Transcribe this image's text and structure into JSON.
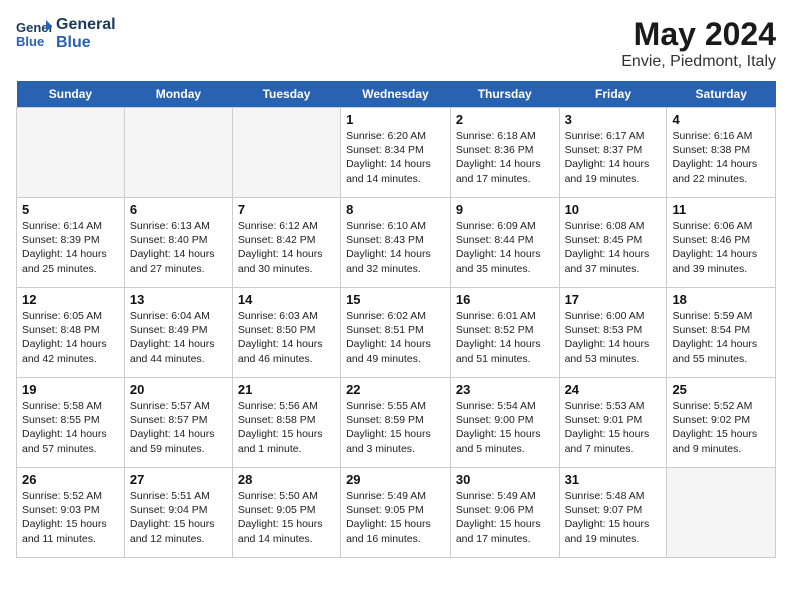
{
  "header": {
    "logo_text_general": "General",
    "logo_text_blue": "Blue",
    "month_year": "May 2024",
    "location": "Envie, Piedmont, Italy"
  },
  "days_of_week": [
    "Sunday",
    "Monday",
    "Tuesday",
    "Wednesday",
    "Thursday",
    "Friday",
    "Saturday"
  ],
  "weeks": [
    [
      {
        "day": "",
        "info": ""
      },
      {
        "day": "",
        "info": ""
      },
      {
        "day": "",
        "info": ""
      },
      {
        "day": "1",
        "info": "Sunrise: 6:20 AM\nSunset: 8:34 PM\nDaylight: 14 hours and 14 minutes."
      },
      {
        "day": "2",
        "info": "Sunrise: 6:18 AM\nSunset: 8:36 PM\nDaylight: 14 hours and 17 minutes."
      },
      {
        "day": "3",
        "info": "Sunrise: 6:17 AM\nSunset: 8:37 PM\nDaylight: 14 hours and 19 minutes."
      },
      {
        "day": "4",
        "info": "Sunrise: 6:16 AM\nSunset: 8:38 PM\nDaylight: 14 hours and 22 minutes."
      }
    ],
    [
      {
        "day": "5",
        "info": "Sunrise: 6:14 AM\nSunset: 8:39 PM\nDaylight: 14 hours and 25 minutes."
      },
      {
        "day": "6",
        "info": "Sunrise: 6:13 AM\nSunset: 8:40 PM\nDaylight: 14 hours and 27 minutes."
      },
      {
        "day": "7",
        "info": "Sunrise: 6:12 AM\nSunset: 8:42 PM\nDaylight: 14 hours and 30 minutes."
      },
      {
        "day": "8",
        "info": "Sunrise: 6:10 AM\nSunset: 8:43 PM\nDaylight: 14 hours and 32 minutes."
      },
      {
        "day": "9",
        "info": "Sunrise: 6:09 AM\nSunset: 8:44 PM\nDaylight: 14 hours and 35 minutes."
      },
      {
        "day": "10",
        "info": "Sunrise: 6:08 AM\nSunset: 8:45 PM\nDaylight: 14 hours and 37 minutes."
      },
      {
        "day": "11",
        "info": "Sunrise: 6:06 AM\nSunset: 8:46 PM\nDaylight: 14 hours and 39 minutes."
      }
    ],
    [
      {
        "day": "12",
        "info": "Sunrise: 6:05 AM\nSunset: 8:48 PM\nDaylight: 14 hours and 42 minutes."
      },
      {
        "day": "13",
        "info": "Sunrise: 6:04 AM\nSunset: 8:49 PM\nDaylight: 14 hours and 44 minutes."
      },
      {
        "day": "14",
        "info": "Sunrise: 6:03 AM\nSunset: 8:50 PM\nDaylight: 14 hours and 46 minutes."
      },
      {
        "day": "15",
        "info": "Sunrise: 6:02 AM\nSunset: 8:51 PM\nDaylight: 14 hours and 49 minutes."
      },
      {
        "day": "16",
        "info": "Sunrise: 6:01 AM\nSunset: 8:52 PM\nDaylight: 14 hours and 51 minutes."
      },
      {
        "day": "17",
        "info": "Sunrise: 6:00 AM\nSunset: 8:53 PM\nDaylight: 14 hours and 53 minutes."
      },
      {
        "day": "18",
        "info": "Sunrise: 5:59 AM\nSunset: 8:54 PM\nDaylight: 14 hours and 55 minutes."
      }
    ],
    [
      {
        "day": "19",
        "info": "Sunrise: 5:58 AM\nSunset: 8:55 PM\nDaylight: 14 hours and 57 minutes."
      },
      {
        "day": "20",
        "info": "Sunrise: 5:57 AM\nSunset: 8:57 PM\nDaylight: 14 hours and 59 minutes."
      },
      {
        "day": "21",
        "info": "Sunrise: 5:56 AM\nSunset: 8:58 PM\nDaylight: 15 hours and 1 minute."
      },
      {
        "day": "22",
        "info": "Sunrise: 5:55 AM\nSunset: 8:59 PM\nDaylight: 15 hours and 3 minutes."
      },
      {
        "day": "23",
        "info": "Sunrise: 5:54 AM\nSunset: 9:00 PM\nDaylight: 15 hours and 5 minutes."
      },
      {
        "day": "24",
        "info": "Sunrise: 5:53 AM\nSunset: 9:01 PM\nDaylight: 15 hours and 7 minutes."
      },
      {
        "day": "25",
        "info": "Sunrise: 5:52 AM\nSunset: 9:02 PM\nDaylight: 15 hours and 9 minutes."
      }
    ],
    [
      {
        "day": "26",
        "info": "Sunrise: 5:52 AM\nSunset: 9:03 PM\nDaylight: 15 hours and 11 minutes."
      },
      {
        "day": "27",
        "info": "Sunrise: 5:51 AM\nSunset: 9:04 PM\nDaylight: 15 hours and 12 minutes."
      },
      {
        "day": "28",
        "info": "Sunrise: 5:50 AM\nSunset: 9:05 PM\nDaylight: 15 hours and 14 minutes."
      },
      {
        "day": "29",
        "info": "Sunrise: 5:49 AM\nSunset: 9:05 PM\nDaylight: 15 hours and 16 minutes."
      },
      {
        "day": "30",
        "info": "Sunrise: 5:49 AM\nSunset: 9:06 PM\nDaylight: 15 hours and 17 minutes."
      },
      {
        "day": "31",
        "info": "Sunrise: 5:48 AM\nSunset: 9:07 PM\nDaylight: 15 hours and 19 minutes."
      },
      {
        "day": "",
        "info": ""
      }
    ]
  ]
}
